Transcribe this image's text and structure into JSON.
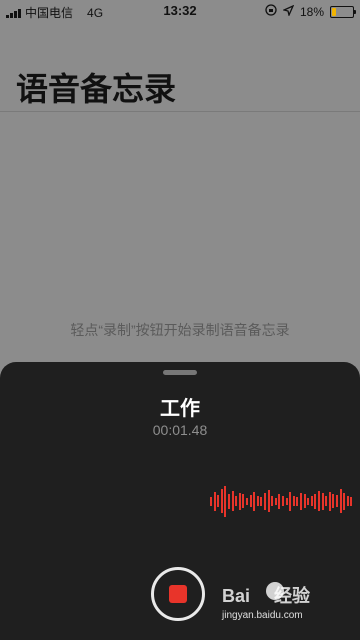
{
  "status": {
    "carrier": "中国电信",
    "network": "4G",
    "time": "13:32",
    "battery": "18%",
    "battery_level": 0.18,
    "icons": [
      "signal-icon",
      "lock-rotation-icon",
      "location-arrow-icon",
      "battery-icon"
    ]
  },
  "app": {
    "title": "语音备忘录",
    "hint": "轻点“录制”按钮开始录制语音备忘录"
  },
  "recording": {
    "name": "工作",
    "elapsed": "00:01.48",
    "waveform_levels": [
      0.25,
      0.55,
      0.35,
      0.7,
      0.9,
      0.45,
      0.6,
      0.3,
      0.5,
      0.4,
      0.2,
      0.35,
      0.55,
      0.3,
      0.25,
      0.5,
      0.65,
      0.3,
      0.2,
      0.45,
      0.3,
      0.2,
      0.55,
      0.3,
      0.25,
      0.5,
      0.4,
      0.2,
      0.3,
      0.45,
      0.6,
      0.5,
      0.3,
      0.55,
      0.4,
      0.35,
      0.7,
      0.5,
      0.3,
      0.25
    ],
    "accent": "#e8342a"
  },
  "watermark": {
    "brand": "Bai",
    "brand_suffix": "经验",
    "url": "jingyan.baidu.com"
  }
}
